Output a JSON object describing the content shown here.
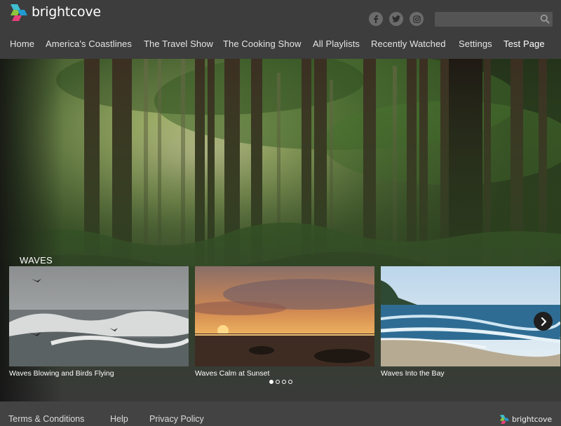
{
  "brand": {
    "name": "brightcove"
  },
  "socials": [
    {
      "icon": "facebook-icon",
      "glyph": "f"
    },
    {
      "icon": "twitter-icon",
      "glyph": "t"
    },
    {
      "icon": "instagram-icon",
      "glyph": "ig"
    }
  ],
  "search": {
    "placeholder": "",
    "value": ""
  },
  "nav": {
    "items": [
      {
        "label": "Home"
      },
      {
        "label": "America's Coastlines"
      },
      {
        "label": "The Travel Show"
      },
      {
        "label": "The Cooking Show"
      },
      {
        "label": "All Playlists"
      },
      {
        "label": "Recently Watched"
      },
      {
        "label": "Settings"
      },
      {
        "label": "Test Page"
      }
    ],
    "active_index": 7
  },
  "playlist": {
    "title": "WAVES",
    "cards": [
      {
        "title": "Waves Blowing and Birds Flying"
      },
      {
        "title": "Waves Calm at Sunset"
      },
      {
        "title": "Waves Into the Bay"
      }
    ],
    "pagination": {
      "pages": 4,
      "current": 1
    }
  },
  "footer": {
    "links": [
      {
        "label": "Terms & Conditions"
      },
      {
        "label": "Help"
      },
      {
        "label": "Privacy Policy"
      }
    ],
    "brand": "brightcove"
  },
  "colors": {
    "header_bg": "#3d3d3d",
    "footer_bg": "#434343",
    "logo_teal": "#3fbfd0",
    "logo_pink": "#e5407a",
    "logo_green": "#8cc63f"
  }
}
